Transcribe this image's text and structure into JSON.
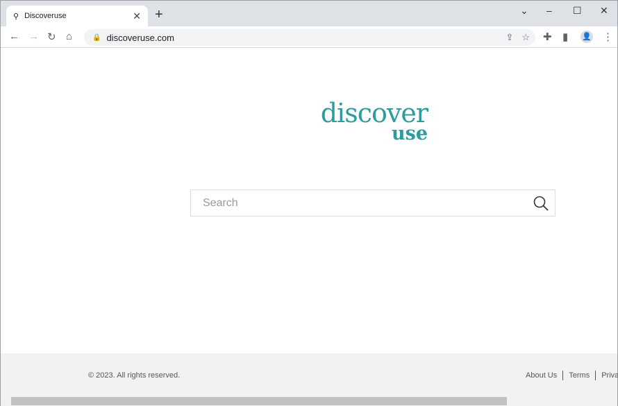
{
  "browser": {
    "tab_title": "Discoveruse",
    "url": "discoveruse.com",
    "icons": [
      "search-icon",
      "close-icon",
      "plus-icon",
      "back-icon",
      "forward-icon",
      "reload-icon",
      "home-icon",
      "lock-icon",
      "share-icon",
      "star-icon",
      "extensions-icon",
      "sidepanel-icon",
      "profile-icon",
      "menu-icon"
    ]
  },
  "logo": {
    "line1": "discover",
    "line2": "use",
    "color": "#2c9c9e"
  },
  "search": {
    "placeholder": "Search",
    "value": ""
  },
  "footer": {
    "copyright": "© 2023. All rights reserved.",
    "links": [
      "About Us",
      "Terms",
      "Privac"
    ]
  }
}
